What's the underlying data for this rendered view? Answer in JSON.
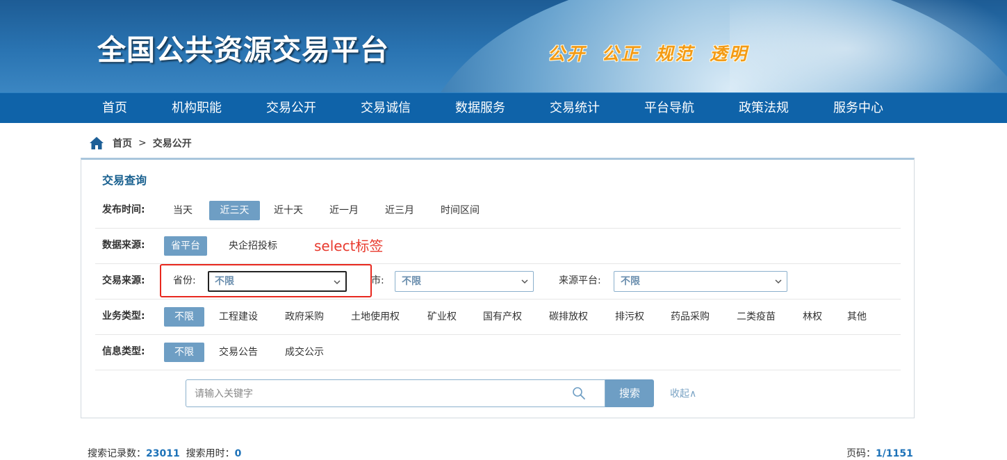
{
  "header": {
    "title": "全国公共资源交易平台",
    "slogan": "公开 公正 规范 透明"
  },
  "nav": [
    "首页",
    "机构职能",
    "交易公开",
    "交易诚信",
    "数据服务",
    "交易统计",
    "平台导航",
    "政策法规",
    "服务中心"
  ],
  "breadcrumb": {
    "home": "首页",
    "separator": ">",
    "current": "交易公开"
  },
  "panel": {
    "title": "交易查询",
    "publish_time": {
      "label": "发布时间:",
      "options": [
        "当天",
        "近三天",
        "近十天",
        "近一月",
        "近三月",
        "时间区间"
      ],
      "selected": "近三天"
    },
    "data_source": {
      "label": "数据来源:",
      "options": [
        "省平台",
        "央企招投标"
      ],
      "selected": "省平台"
    },
    "trade_source": {
      "label": "交易来源:",
      "province_label": "省份:",
      "province_value": "不限",
      "city_label": "市:",
      "city_value": "不限",
      "platform_label": "来源平台:",
      "platform_value": "不限"
    },
    "business_type": {
      "label": "业务类型:",
      "options": [
        "不限",
        "工程建设",
        "政府采购",
        "土地使用权",
        "矿业权",
        "国有产权",
        "碳排放权",
        "排污权",
        "药品采购",
        "二类疫苗",
        "林权",
        "其他"
      ],
      "selected": "不限"
    },
    "info_type": {
      "label": "信息类型:",
      "options": [
        "不限",
        "交易公告",
        "成交公示"
      ],
      "selected": "不限"
    },
    "search": {
      "placeholder": "请输入关键字",
      "button": "搜索",
      "collapse": "收起∧"
    }
  },
  "annotation": "select标签",
  "results": {
    "records_label": "搜索记录数：",
    "records": "23011",
    "time_label": "搜索用时：",
    "time": "0",
    "page_label": "页码：",
    "page": "1/1151"
  },
  "colors": {
    "nav": "#0f63a9",
    "active_option": "#6e9ec4",
    "annotation": "#e83a2e",
    "slogan": "#f39a14"
  }
}
